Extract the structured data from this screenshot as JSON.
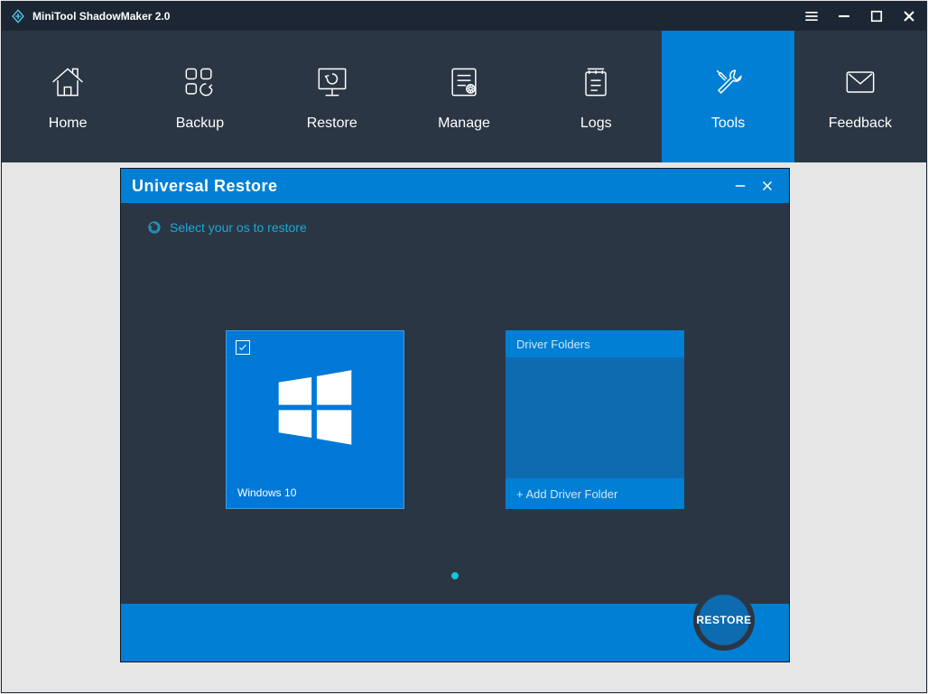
{
  "titlebar": {
    "title": "MiniTool ShadowMaker 2.0"
  },
  "nav": {
    "items": [
      {
        "label": "Home"
      },
      {
        "label": "Backup"
      },
      {
        "label": "Restore"
      },
      {
        "label": "Manage"
      },
      {
        "label": "Logs"
      },
      {
        "label": "Tools"
      },
      {
        "label": "Feedback"
      }
    ],
    "active_index": 5
  },
  "dialog": {
    "title": "Universal Restore",
    "subtitle": "Select your os to restore",
    "os_tile": {
      "name": "Windows 10",
      "checked": true
    },
    "driver_panel": {
      "header": "Driver Folders",
      "add_label": "+ Add Driver Folder"
    },
    "footer": {
      "restore_label": "RESTORE"
    }
  }
}
